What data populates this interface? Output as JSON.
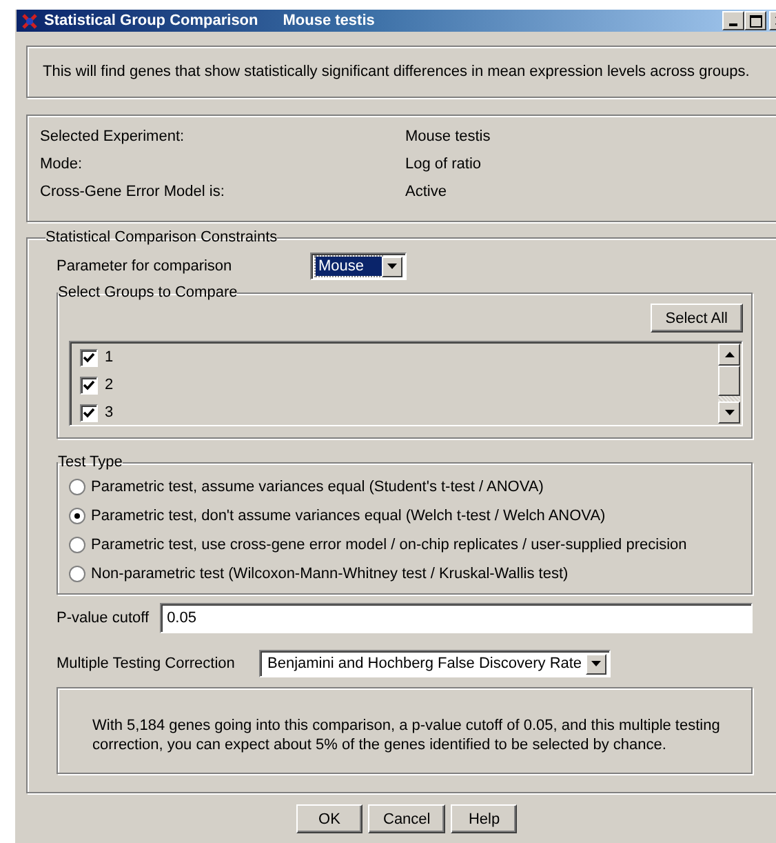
{
  "window": {
    "title": "Statistical Group Comparison",
    "subtitle": "Mouse testis"
  },
  "intro": "This will find genes that show statistically significant differences in mean expression levels across groups.",
  "info": [
    {
      "label": "Selected Experiment:",
      "value": "Mouse testis"
    },
    {
      "label": "Mode:",
      "value": "Log of ratio"
    },
    {
      "label": "Cross-Gene Error Model is:",
      "value": "Active"
    }
  ],
  "constraints": {
    "title": "Statistical Comparison Constraints",
    "parameter": {
      "label": "Parameter for comparison",
      "value": "Mouse"
    },
    "groups": {
      "title": "Select Groups to Compare",
      "select_all": "Select All",
      "items": [
        {
          "label": "1",
          "checked": true
        },
        {
          "label": "2",
          "checked": true
        },
        {
          "label": "3",
          "checked": true
        }
      ]
    },
    "test_type": {
      "title": "Test Type",
      "options": [
        {
          "label": "Parametric test, assume variances equal (Student's t-test / ANOVA)",
          "selected": false
        },
        {
          "label": "Parametric test, don't assume variances equal (Welch t-test / Welch ANOVA)",
          "selected": true
        },
        {
          "label": "Parametric test, use cross-gene error model / on-chip replicates / user-supplied precision",
          "selected": false
        },
        {
          "label": "Non-parametric test (Wilcoxon-Mann-Whitney test / Kruskal-Wallis test)",
          "selected": false
        }
      ]
    },
    "p_value": {
      "label": "P-value cutoff",
      "value": "0.05"
    },
    "correction": {
      "label": "Multiple Testing Correction",
      "value": "Benjamini and Hochberg False Discovery Rate"
    },
    "note": "With 5,184 genes going into this comparison, a p-value cutoff of 0.05, and this multiple testing correction, you can expect about 5% of the genes identified to be selected by chance."
  },
  "buttons": [
    "OK",
    "Cancel",
    "Help"
  ]
}
